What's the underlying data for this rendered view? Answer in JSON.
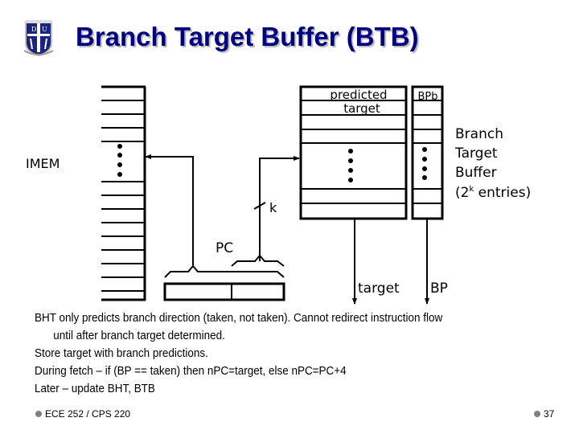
{
  "header": {
    "title": "Branch Target Buffer (BTB)",
    "logo_icon": "university-shield-logo-icon",
    "title_color": "#000080"
  },
  "diagram": {
    "imem_label": "IMEM",
    "btb_header_line1": "predicted",
    "btb_header_line2": "target",
    "bpb_header": "BPb",
    "btb_caption": [
      "Branch",
      "Target",
      "Buffer"
    ],
    "btb_entries_prefix": "(2",
    "btb_entries_exp": "k",
    "btb_entries_suffix": " entries)",
    "k_label": "k",
    "pc_label": "PC",
    "target_out_label": "target",
    "bp_out_label": "BP"
  },
  "bullets": [
    "BHT only predicts branch direction (taken, not taken). Cannot redirect instruction flow",
    "until after branch target determined.",
    "Store target with branch predictions.",
    "During fetch – if (BP == taken) then nPC=target, else nPC=PC+4",
    "Later – update BHT, BTB"
  ],
  "footer": {
    "course": "ECE 252 / CPS 220",
    "page_number": "37"
  }
}
